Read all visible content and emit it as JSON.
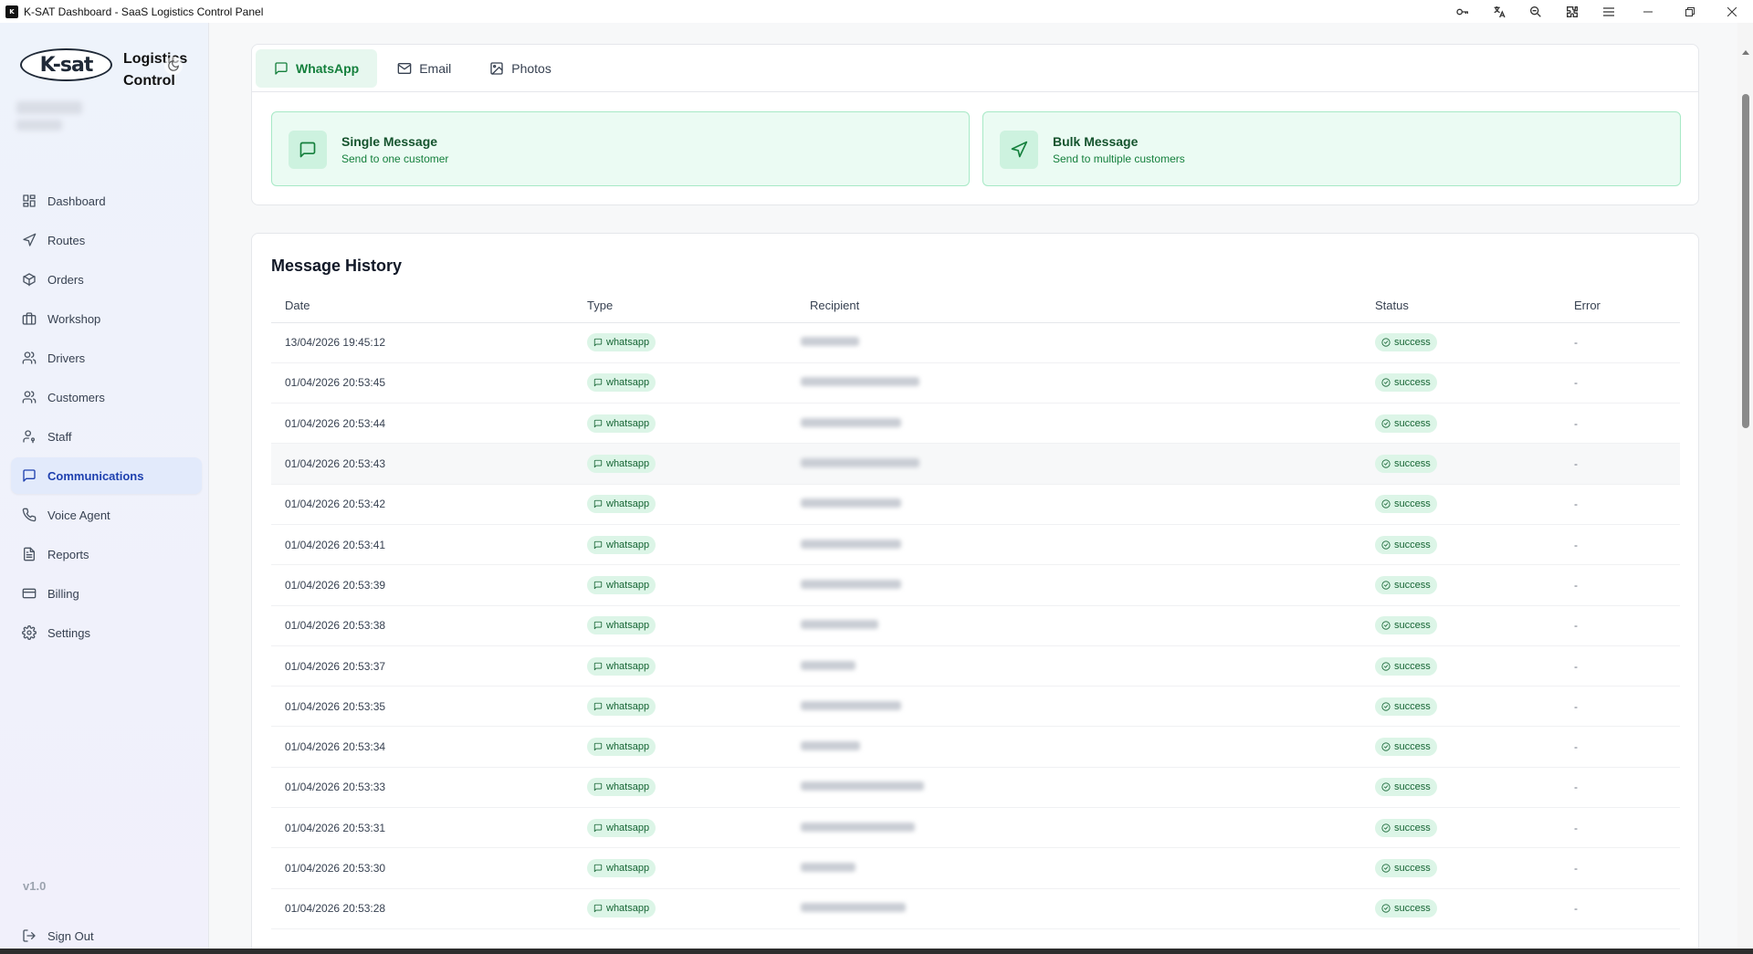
{
  "window": {
    "title": "K-SAT Dashboard - SaaS Logistics Control Panel",
    "logo_text": "K"
  },
  "brand": {
    "logo_text": "K-sat",
    "title": "Logistics Control"
  },
  "sidebar": {
    "items": [
      {
        "label": "Dashboard",
        "icon": "dashboard-icon"
      },
      {
        "label": "Routes",
        "icon": "navigation-icon"
      },
      {
        "label": "Orders",
        "icon": "package-icon"
      },
      {
        "label": "Workshop",
        "icon": "briefcase-icon"
      },
      {
        "label": "Drivers",
        "icon": "users-icon"
      },
      {
        "label": "Customers",
        "icon": "users-icon"
      },
      {
        "label": "Staff",
        "icon": "user-key-icon"
      },
      {
        "label": "Communications",
        "icon": "message-icon",
        "active": true
      },
      {
        "label": "Voice Agent",
        "icon": "phone-icon"
      },
      {
        "label": "Reports",
        "icon": "file-text-icon"
      },
      {
        "label": "Billing",
        "icon": "credit-card-icon"
      },
      {
        "label": "Settings",
        "icon": "gear-icon"
      }
    ],
    "version": "v1.0",
    "sign_out": "Sign Out"
  },
  "tabs": [
    {
      "label": "WhatsApp",
      "active": true
    },
    {
      "label": "Email"
    },
    {
      "label": "Photos"
    }
  ],
  "options": {
    "single": {
      "title": "Single Message",
      "subtitle": "Send to one customer"
    },
    "bulk": {
      "title": "Bulk Message",
      "subtitle": "Send to multiple customers"
    }
  },
  "history": {
    "title": "Message History",
    "columns": {
      "date": "Date",
      "type": "Type",
      "recipient": "Recipient",
      "status": "Status",
      "error": "Error"
    },
    "rows": [
      {
        "date": "13/04/2026 19:45:12",
        "type": "whatsapp",
        "status": "success",
        "error": "-"
      },
      {
        "date": "01/04/2026 20:53:45",
        "type": "whatsapp",
        "status": "success",
        "error": "-"
      },
      {
        "date": "01/04/2026 20:53:44",
        "type": "whatsapp",
        "status": "success",
        "error": "-"
      },
      {
        "date": "01/04/2026 20:53:43",
        "type": "whatsapp",
        "status": "success",
        "error": "-"
      },
      {
        "date": "01/04/2026 20:53:42",
        "type": "whatsapp",
        "status": "success",
        "error": "-"
      },
      {
        "date": "01/04/2026 20:53:41",
        "type": "whatsapp",
        "status": "success",
        "error": "-"
      },
      {
        "date": "01/04/2026 20:53:39",
        "type": "whatsapp",
        "status": "success",
        "error": "-"
      },
      {
        "date": "01/04/2026 20:53:38",
        "type": "whatsapp",
        "status": "success",
        "error": "-"
      },
      {
        "date": "01/04/2026 20:53:37",
        "type": "whatsapp",
        "status": "success",
        "error": "-"
      },
      {
        "date": "01/04/2026 20:53:35",
        "type": "whatsapp",
        "status": "success",
        "error": "-"
      },
      {
        "date": "01/04/2026 20:53:34",
        "type": "whatsapp",
        "status": "success",
        "error": "-"
      },
      {
        "date": "01/04/2026 20:53:33",
        "type": "whatsapp",
        "status": "success",
        "error": "-"
      },
      {
        "date": "01/04/2026 20:53:31",
        "type": "whatsapp",
        "status": "success",
        "error": "-"
      },
      {
        "date": "01/04/2026 20:53:30",
        "type": "whatsapp",
        "status": "success",
        "error": "-"
      },
      {
        "date": "01/04/2026 20:53:28",
        "type": "whatsapp",
        "status": "success",
        "error": "-"
      }
    ]
  },
  "colors": {
    "accent": "#15803d",
    "nav_active": "#1e40af",
    "success_bg": "#dcf5e7"
  }
}
